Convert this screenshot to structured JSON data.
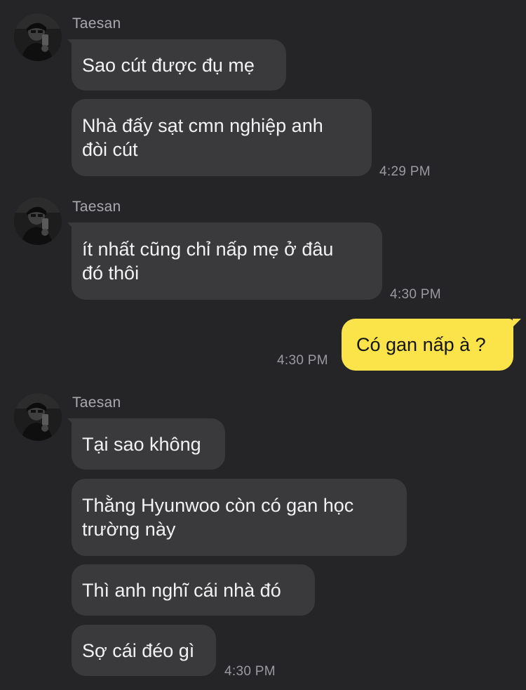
{
  "groups": [
    {
      "sender": "Taesan",
      "messages": [
        {
          "lines": [
            "Sao cút được đụ mẹ"
          ]
        },
        {
          "lines": [
            "Nhà đấy sạt cmn nghiệp anh",
            "đòi cút"
          ]
        }
      ],
      "time": "4:29 PM"
    },
    {
      "sender": "Taesan",
      "messages": [
        {
          "lines": [
            "ít nhất cũng chỉ nấp mẹ ở đâu",
            "đó thôi"
          ]
        }
      ],
      "time": "4:30 PM"
    },
    {
      "sender": "me",
      "messages": [
        {
          "lines": [
            "Có gan nấp à ?"
          ]
        }
      ],
      "time": "4:30 PM"
    },
    {
      "sender": "Taesan",
      "messages": [
        {
          "lines": [
            "Tại sao không"
          ]
        },
        {
          "lines": [
            "Thằng Hyunwoo còn có gan học",
            "trường này"
          ]
        },
        {
          "lines": [
            "Thì anh nghĩ cái nhà đó"
          ]
        },
        {
          "lines": [
            "Sợ cái đéo gì"
          ]
        }
      ],
      "time": "4:30 PM"
    }
  ],
  "colors": {
    "background": "#252527",
    "incoming_bubble": "#3a3a3d",
    "outgoing_bubble": "#fae44a",
    "sender_name": "#a9a9ae",
    "timestamp": "#9a9aa0"
  },
  "icons": {
    "avatar": "profile-photo"
  }
}
